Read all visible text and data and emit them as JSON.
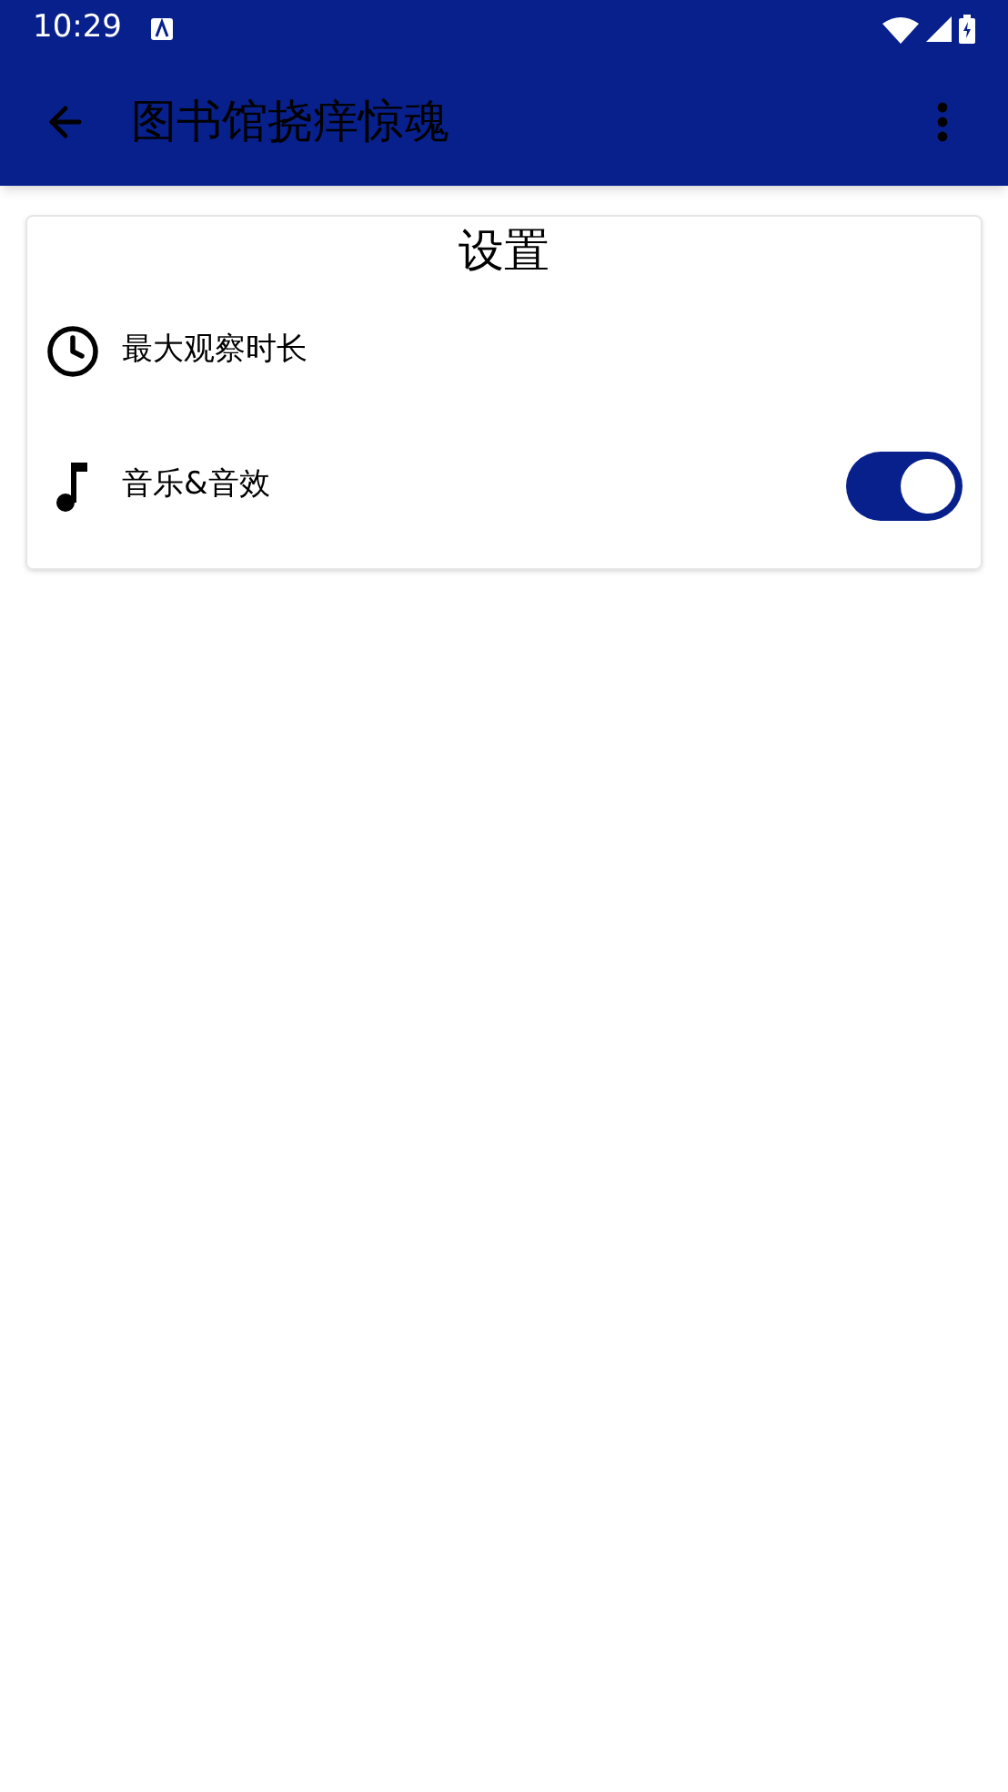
{
  "status_bar": {
    "time": "10:29"
  },
  "app_bar": {
    "title": "图书馆挠痒惊魂"
  },
  "settings_card": {
    "title": "设置",
    "rows": [
      {
        "kind": "plain",
        "label": "最大观察时长"
      },
      {
        "kind": "switch",
        "label": "音乐&音效",
        "on": true
      }
    ]
  }
}
